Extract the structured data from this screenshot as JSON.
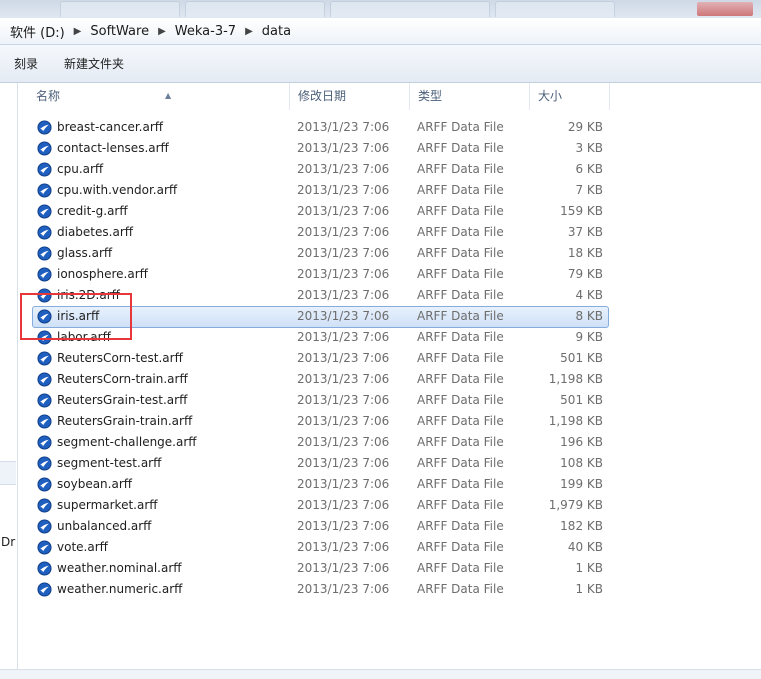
{
  "breadcrumb": [
    "软件 (D:)",
    "SoftWare",
    "Weka-3-7",
    "data"
  ],
  "toolbar": {
    "burn_label": "刻录",
    "new_folder_label": "新建文件夹"
  },
  "columns": {
    "name": "名称",
    "date": "修改日期",
    "type": "类型",
    "size": "大小"
  },
  "nav_fragment": "Dr",
  "files": [
    {
      "name": "breast-cancer.arff",
      "date": "2013/1/23 7:06",
      "type": "ARFF Data File",
      "size": "29 KB"
    },
    {
      "name": "contact-lenses.arff",
      "date": "2013/1/23 7:06",
      "type": "ARFF Data File",
      "size": "3 KB"
    },
    {
      "name": "cpu.arff",
      "date": "2013/1/23 7:06",
      "type": "ARFF Data File",
      "size": "6 KB"
    },
    {
      "name": "cpu.with.vendor.arff",
      "date": "2013/1/23 7:06",
      "type": "ARFF Data File",
      "size": "7 KB"
    },
    {
      "name": "credit-g.arff",
      "date": "2013/1/23 7:06",
      "type": "ARFF Data File",
      "size": "159 KB"
    },
    {
      "name": "diabetes.arff",
      "date": "2013/1/23 7:06",
      "type": "ARFF Data File",
      "size": "37 KB"
    },
    {
      "name": "glass.arff",
      "date": "2013/1/23 7:06",
      "type": "ARFF Data File",
      "size": "18 KB"
    },
    {
      "name": "ionosphere.arff",
      "date": "2013/1/23 7:06",
      "type": "ARFF Data File",
      "size": "79 KB"
    },
    {
      "name": "iris.2D.arff",
      "date": "2013/1/23 7:06",
      "type": "ARFF Data File",
      "size": "4 KB"
    },
    {
      "name": "iris.arff",
      "date": "2013/1/23 7:06",
      "type": "ARFF Data File",
      "size": "8 KB"
    },
    {
      "name": "labor.arff",
      "date": "2013/1/23 7:06",
      "type": "ARFF Data File",
      "size": "9 KB"
    },
    {
      "name": "ReutersCorn-test.arff",
      "date": "2013/1/23 7:06",
      "type": "ARFF Data File",
      "size": "501 KB"
    },
    {
      "name": "ReutersCorn-train.arff",
      "date": "2013/1/23 7:06",
      "type": "ARFF Data File",
      "size": "1,198 KB"
    },
    {
      "name": "ReutersGrain-test.arff",
      "date": "2013/1/23 7:06",
      "type": "ARFF Data File",
      "size": "501 KB"
    },
    {
      "name": "ReutersGrain-train.arff",
      "date": "2013/1/23 7:06",
      "type": "ARFF Data File",
      "size": "1,198 KB"
    },
    {
      "name": "segment-challenge.arff",
      "date": "2013/1/23 7:06",
      "type": "ARFF Data File",
      "size": "196 KB"
    },
    {
      "name": "segment-test.arff",
      "date": "2013/1/23 7:06",
      "type": "ARFF Data File",
      "size": "108 KB"
    },
    {
      "name": "soybean.arff",
      "date": "2013/1/23 7:06",
      "type": "ARFF Data File",
      "size": "199 KB"
    },
    {
      "name": "supermarket.arff",
      "date": "2013/1/23 7:06",
      "type": "ARFF Data File",
      "size": "1,979 KB"
    },
    {
      "name": "unbalanced.arff",
      "date": "2013/1/23 7:06",
      "type": "ARFF Data File",
      "size": "182 KB"
    },
    {
      "name": "vote.arff",
      "date": "2013/1/23 7:06",
      "type": "ARFF Data File",
      "size": "40 KB"
    },
    {
      "name": "weather.nominal.arff",
      "date": "2013/1/23 7:06",
      "type": "ARFF Data File",
      "size": "1 KB"
    },
    {
      "name": "weather.numeric.arff",
      "date": "2013/1/23 7:06",
      "type": "ARFF Data File",
      "size": "1 KB"
    }
  ],
  "selected_file": "iris.arff",
  "file_icon": "weka-bird-icon",
  "colors": {
    "accent": "#1f5fbf",
    "highlight_box": "#e8373a",
    "selection": "#cfe1f7"
  }
}
